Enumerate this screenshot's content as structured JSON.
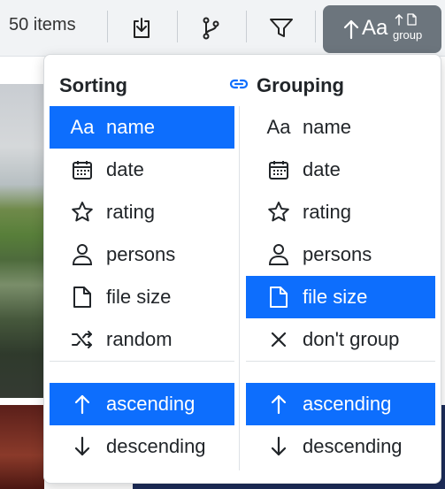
{
  "toolbar": {
    "item_count": "50 items",
    "sort_button": {
      "aa": "Aa",
      "group": "group"
    }
  },
  "sorting": {
    "heading": "Sorting",
    "fields": [
      {
        "label": "name",
        "icon": "font-icon",
        "active": true
      },
      {
        "label": "date",
        "icon": "calendar-icon",
        "active": false
      },
      {
        "label": "rating",
        "icon": "star-icon",
        "active": false
      },
      {
        "label": "persons",
        "icon": "person-icon",
        "active": false
      },
      {
        "label": "file size",
        "icon": "file-icon",
        "active": false
      },
      {
        "label": "random",
        "icon": "shuffle-icon",
        "active": false
      }
    ],
    "order": [
      {
        "label": "ascending",
        "icon": "arrow-up-icon",
        "active": true
      },
      {
        "label": "descending",
        "icon": "arrow-down-icon",
        "active": false
      }
    ]
  },
  "grouping": {
    "heading": "Grouping",
    "fields": [
      {
        "label": "name",
        "icon": "font-icon",
        "active": false
      },
      {
        "label": "date",
        "icon": "calendar-icon",
        "active": false
      },
      {
        "label": "rating",
        "icon": "star-icon",
        "active": false
      },
      {
        "label": "persons",
        "icon": "person-icon",
        "active": false
      },
      {
        "label": "file size",
        "icon": "file-icon",
        "active": true
      },
      {
        "label": "don't group",
        "icon": "x-icon",
        "active": false
      }
    ],
    "order": [
      {
        "label": "ascending",
        "icon": "arrow-up-icon",
        "active": true
      },
      {
        "label": "descending",
        "icon": "arrow-down-icon",
        "active": false
      }
    ]
  },
  "font_icon_glyph": "Aa",
  "colors": {
    "accent": "#0d6efd",
    "sort_button": "#6c757d"
  }
}
